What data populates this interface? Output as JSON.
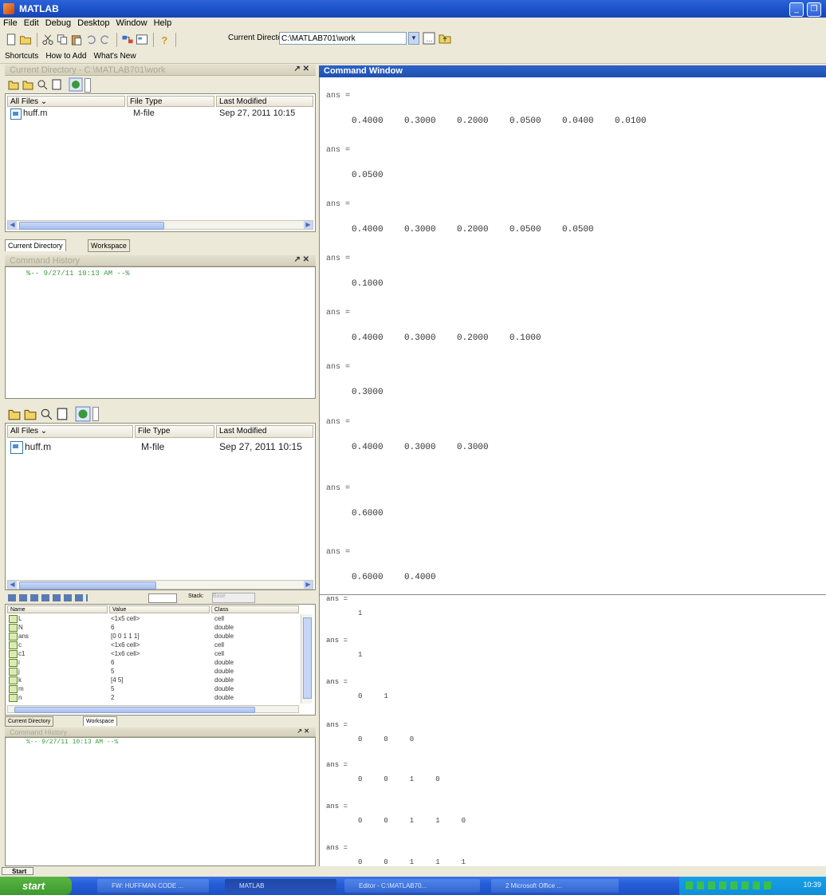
{
  "window": {
    "title": "MATLAB"
  },
  "menu": [
    "File",
    "Edit",
    "Debug",
    "Desktop",
    "Window",
    "Help"
  ],
  "toolbar": {
    "current_directory_label": "Current Directory:",
    "current_directory_value": "C:\\MATLAB701\\work"
  },
  "shortcuts": {
    "label": "Shortcuts",
    "how_to_add": "How to Add",
    "whats_new": "What's New"
  },
  "current_directory_panel": {
    "title": "Current Directory - C:\\MATLAB701\\work",
    "columns": [
      "All Files",
      "File Type",
      "Last Modified"
    ],
    "rows": [
      {
        "name": "huff.m",
        "type": "M-file",
        "modified": "Sep 27, 2011 10:15"
      }
    ],
    "tabs": [
      "Current Directory",
      "Workspace"
    ]
  },
  "command_history_panel": {
    "title": "Command History",
    "entries": [
      "%-- 9/27/11 10:13 AM --%"
    ]
  },
  "current_directory_panel_2": {
    "columns": [
      "All Files",
      "File Type",
      "Last Modified"
    ],
    "rows": [
      {
        "name": "huff.m",
        "type": "M-file",
        "modified": "Sep 27, 2011 10:15"
      }
    ]
  },
  "workspace_panel": {
    "stack_label": "Stack:",
    "stack_value": "Base",
    "columns": [
      "Name",
      "Value",
      "Class"
    ],
    "rows": [
      {
        "name": "L",
        "value": "<1x5 cell>",
        "class": "cell"
      },
      {
        "name": "N",
        "value": "6",
        "class": "double"
      },
      {
        "name": "ans",
        "value": "[0 0 1 1 1]",
        "class": "double"
      },
      {
        "name": "c",
        "value": "<1x6 cell>",
        "class": "cell"
      },
      {
        "name": "c1",
        "value": "<1x6 cell>",
        "class": "cell"
      },
      {
        "name": "i",
        "value": "6",
        "class": "double"
      },
      {
        "name": "j",
        "value": "5",
        "class": "double"
      },
      {
        "name": "k",
        "value": "[4 5]",
        "class": "double"
      },
      {
        "name": "m",
        "value": "5",
        "class": "double"
      },
      {
        "name": "n",
        "value": "2",
        "class": "double"
      }
    ],
    "tabs": [
      "Current Directory",
      "Workspace"
    ]
  },
  "command_history_panel_2": {
    "title": "Command History",
    "entries": [
      "%-- 9/27/11 10:13 AM --%"
    ]
  },
  "command_window": {
    "title": "Command Window",
    "outputs": [
      {
        "label": "ans =",
        "values": "0.4000    0.3000    0.2000    0.0500    0.0400    0.0100"
      },
      {
        "label": "ans =",
        "values": "0.0500"
      },
      {
        "label": "ans =",
        "values": "0.4000    0.3000    0.2000    0.0500    0.0500"
      },
      {
        "label": "ans =",
        "values": "0.1000"
      },
      {
        "label": "ans =",
        "values": "0.4000    0.3000    0.2000    0.1000"
      },
      {
        "label": "ans =",
        "values": "0.3000"
      },
      {
        "label": "ans =",
        "values": "0.4000    0.3000    0.3000"
      },
      {
        "label": "ans =",
        "values": "0.6000"
      },
      {
        "label": "ans =",
        "values": "0.6000    0.4000"
      }
    ],
    "outputs_2": [
      {
        "label": "ans =",
        "values": "1"
      },
      {
        "label": "ans =",
        "values": "1"
      },
      {
        "label": "ans =",
        "values": "0     1"
      },
      {
        "label": "ans =",
        "values": "0     0     0"
      },
      {
        "label": "ans =",
        "values": "0     0     1     0"
      },
      {
        "label": "ans =",
        "values": "0     0     1     1     0"
      },
      {
        "label": "ans =",
        "values": "0     0     1     1     1"
      }
    ]
  },
  "start_bar": {
    "label": "Start"
  },
  "taskbar": {
    "start": "start",
    "tasks": [
      "FW: HUFFMAN CODE ...",
      "MATLAB",
      "Editor - C:\\MATLAB70...",
      "2 Microsoft Office ..."
    ],
    "clock": "10:39"
  }
}
